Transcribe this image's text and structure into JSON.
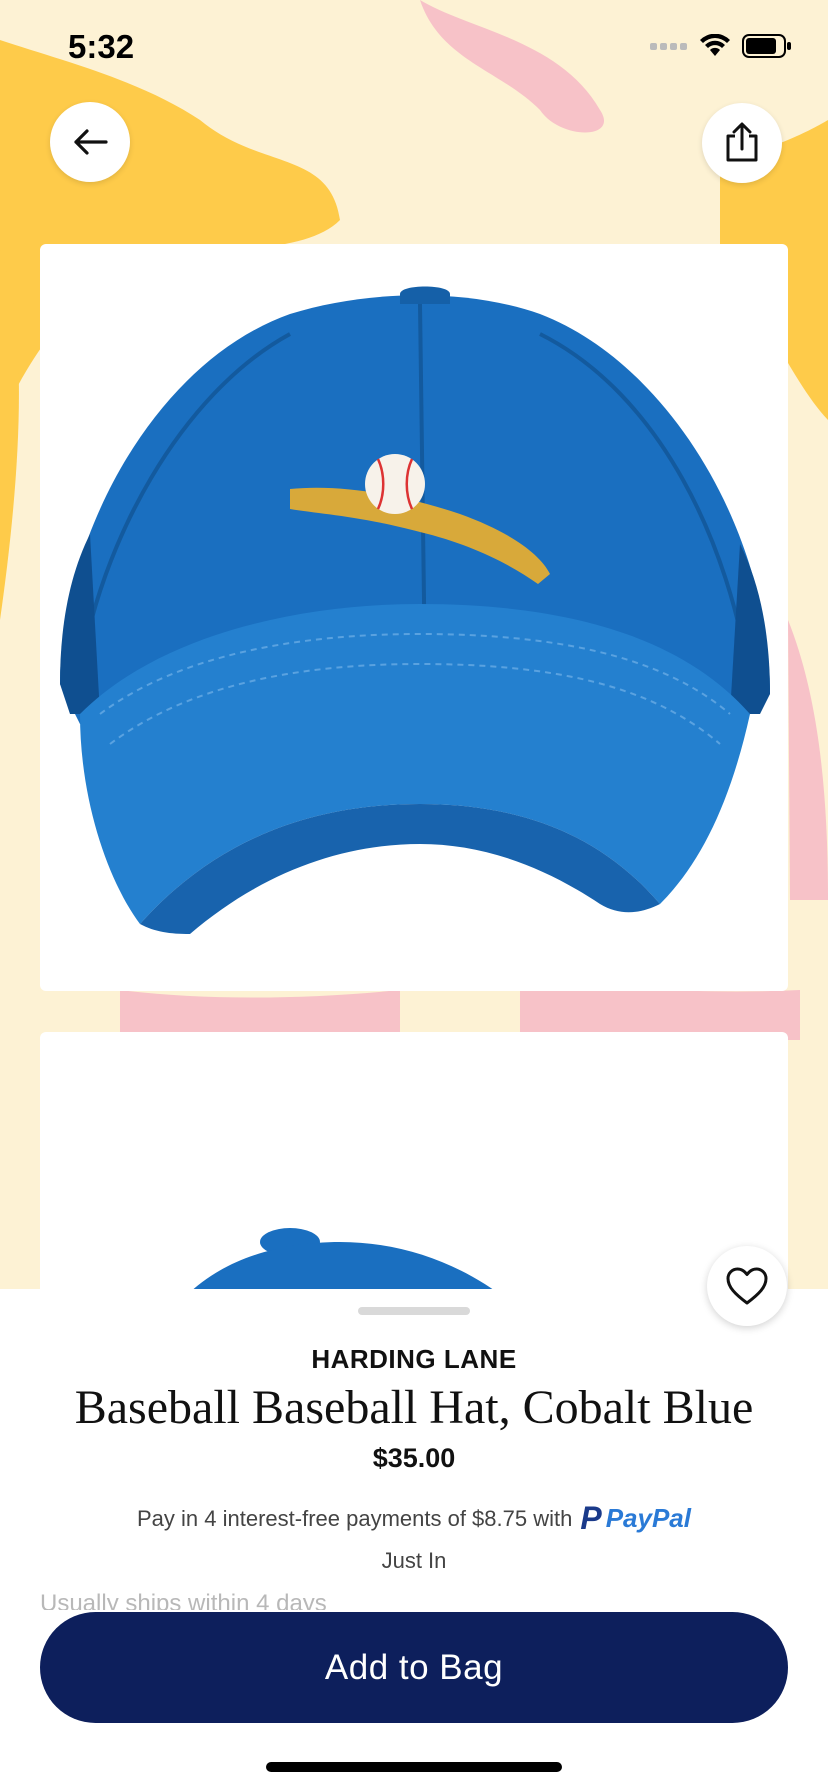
{
  "status_bar": {
    "time": "5:32"
  },
  "product": {
    "brand": "HARDING LANE",
    "title": "Baseball Baseball Hat, Cobalt Blue",
    "price": "$35.00",
    "paypal_text": "Pay in 4 interest-free payments of $8.75 with",
    "paypal_logo_text": "PayPal",
    "tag": "Just In",
    "shipping": "Usually ships within 4 days"
  },
  "actions": {
    "add_to_bag": "Add to Bag"
  },
  "icons": {
    "back": "back-arrow-icon",
    "share": "share-icon",
    "favorite": "heart-icon"
  },
  "colors": {
    "button_bg": "#0d1f5c",
    "hat_blue": "#1a6fc0",
    "background": "#fdf2d4"
  }
}
